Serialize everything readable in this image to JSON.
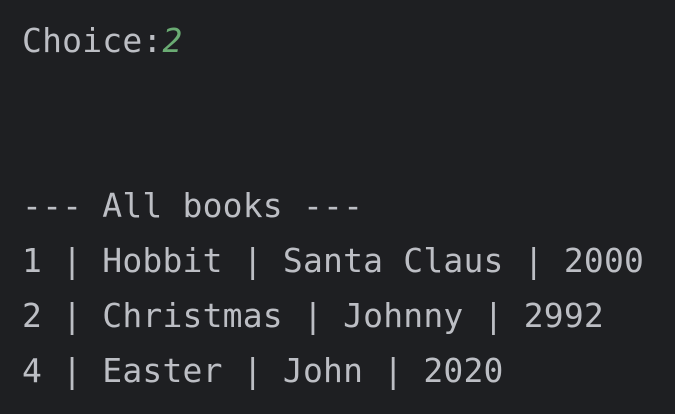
{
  "console": {
    "prompt_label": "Choice:",
    "prompt_input": "2",
    "header": "--- All books ---",
    "rows": [
      "1 | Hobbit | Santa Claus | 2000",
      "2 | Christmas | Johnny | 2992",
      "4 | Easter | John | 2020"
    ]
  },
  "colors": {
    "background": "#1e1f22",
    "text": "#bcbec4",
    "user_input": "#6aab73"
  }
}
